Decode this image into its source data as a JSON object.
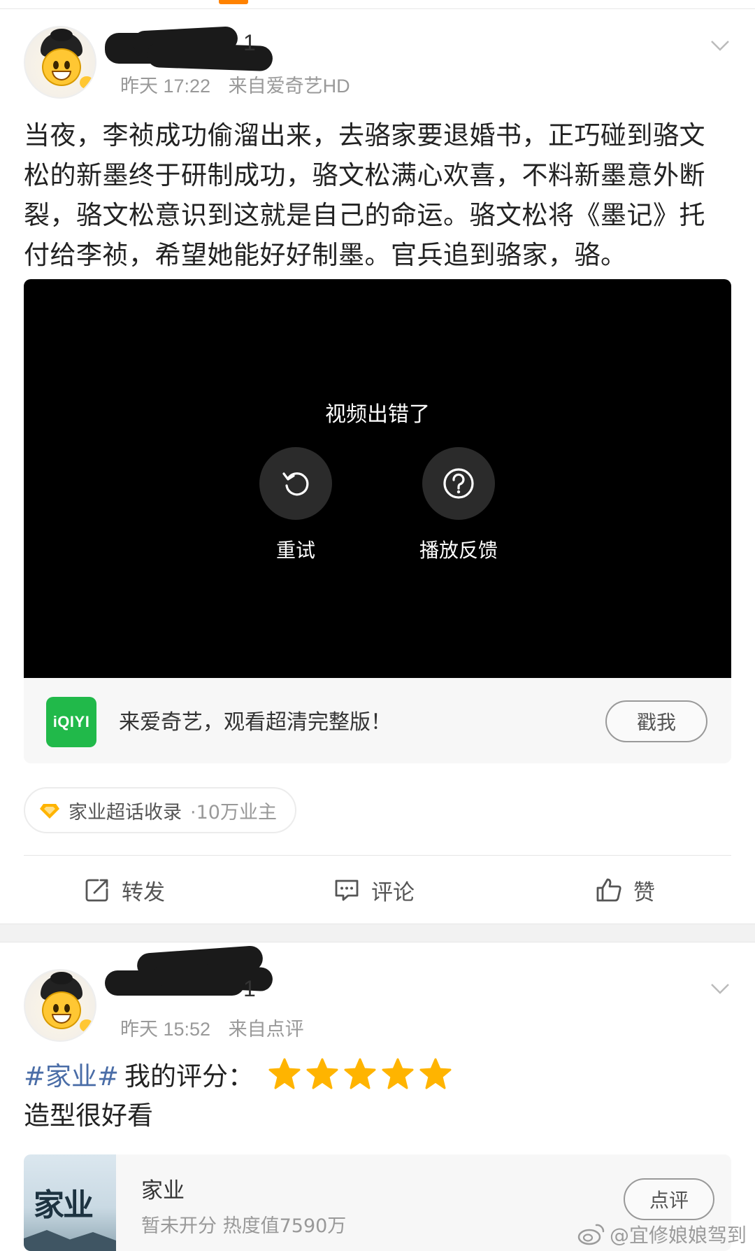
{
  "post1": {
    "username_tail": "1",
    "time": "昨天 17:22",
    "source": "来自爱奇艺HD",
    "text": "当夜，李祯成功偷溜出来，去骆家要退婚书，正巧碰到骆文松的新墨终于研制成功，骆文松满心欢喜，不料新墨意外断裂，骆文松意识到这就是自己的命运。骆文松将《墨记》托付给李祯，希望她能好好制墨。官兵追到骆家，骆。",
    "video": {
      "error_text": "视频出错了",
      "retry_label": "重试",
      "feedback_label": "播放反馈"
    },
    "promo": {
      "logo_text": "iQIYI",
      "text": "来爱奇艺，观看超清完整版！",
      "button_label": "戳我"
    },
    "topic": {
      "name": "家业超话收录",
      "count": "·10万业主"
    },
    "actions": {
      "repost": "转发",
      "comment": "评论",
      "like": "赞"
    }
  },
  "post2": {
    "username_tail": "1",
    "time": "昨天 15:52",
    "source": "来自点评",
    "hashtag": "#家业#",
    "rating_label": "我的评分：",
    "rating_stars": 5,
    "text": "造型很好看",
    "card": {
      "poster_text": "家业",
      "name": "家业",
      "info": "暂未开分 热度值7590万",
      "button_label": "点评"
    }
  },
  "watermark": "@宜修娘娘驾到",
  "colors": {
    "accent_orange": "#ff8200",
    "hashtag_blue": "#4a6da7",
    "star_yellow": "#ffb400",
    "iqiyi_green": "#21b94a"
  }
}
